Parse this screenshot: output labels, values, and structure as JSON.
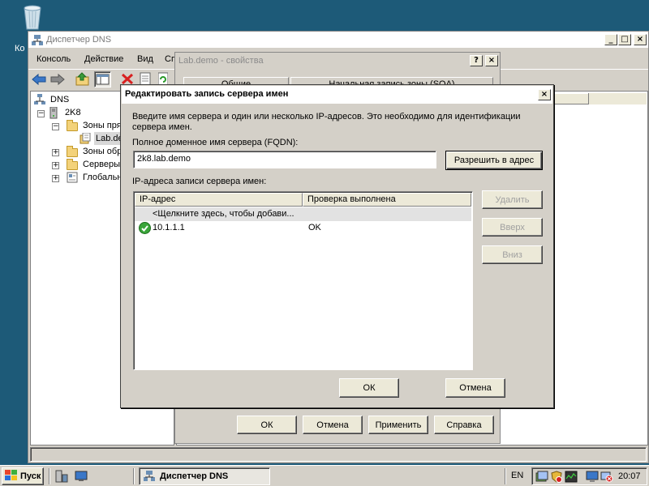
{
  "desktop": {
    "recycle_label": "Ко"
  },
  "dns_window": {
    "title": "Диспетчер DNS",
    "menu": [
      "Консоль",
      "Действие",
      "Вид",
      "Сп"
    ],
    "tree": {
      "root": "DNS",
      "server": "2K8",
      "forward_zones": "Зоны пря",
      "zone": "Lab.de",
      "reverse_zones": "Зоны обра",
      "conditional": "Серверы",
      "global": "Глобальн"
    }
  },
  "props_dialog": {
    "title": "Lab.demo - свойства",
    "tab1": "Общие",
    "tab2": "Начальная запись зоны (SOA)",
    "ok": "ОК",
    "cancel": "Отмена",
    "apply": "Применить",
    "help": "Справка"
  },
  "edit_dialog": {
    "title": "Редактировать запись сервера имен",
    "description": "Введите имя сервера и один или несколько IP-адресов.  Это необходимо для идентификации сервера имен.",
    "fqdn_label": "Полное доменное имя сервера (FQDN):",
    "fqdn_value": "2k8.lab.demo",
    "resolve_button": "Разрешить в адрес",
    "ip_label": "IP-адреса записи сервера имен:",
    "columns": [
      "IP-адрес",
      "Проверка выполнена"
    ],
    "placeholder_row": "<Щелкните здесь, чтобы добави...",
    "rows": [
      {
        "ip": "10.1.1.1",
        "status": "OK"
      }
    ],
    "delete_button": "Удалить",
    "up_button": "Вверх",
    "down_button": "Вниз",
    "ok": "ОК",
    "cancel": "Отмена"
  },
  "taskbar": {
    "start": "Пуск",
    "task": "Диспетчер DNS",
    "lang": "EN",
    "clock": "20:07"
  }
}
